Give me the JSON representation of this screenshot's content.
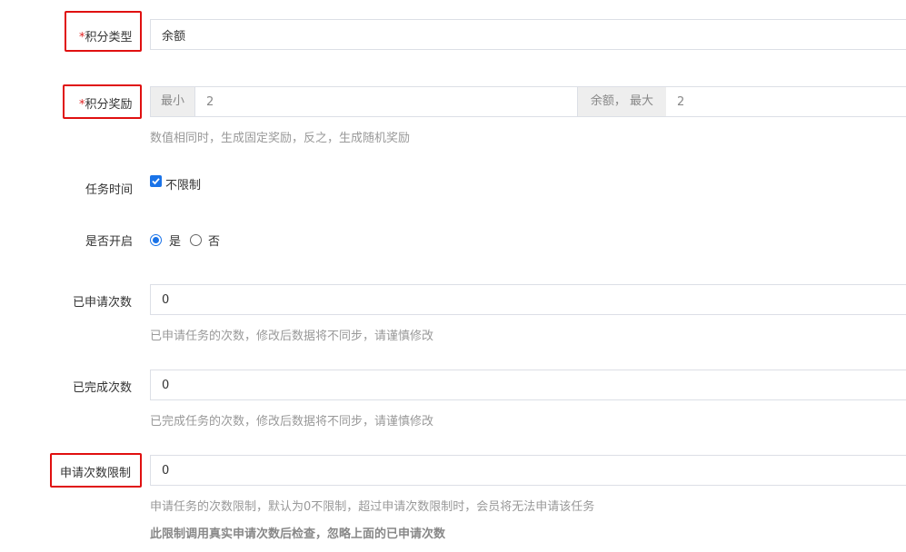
{
  "fields": {
    "points_type": {
      "label": "积分类型",
      "required_mark": "*",
      "value": "余额"
    },
    "points_reward": {
      "label": "积分奖励",
      "required_mark": "*",
      "min_addon": "最小",
      "min_value": "2",
      "max_addon": "余额， 最大",
      "max_value": "2",
      "help": "数值相同时，生成固定奖励，反之，生成随机奖励"
    },
    "task_time": {
      "label": "任务时间",
      "checkbox_label": "不限制",
      "checked": true
    },
    "enabled": {
      "label": "是否开启",
      "yes_label": "是",
      "no_label": "否",
      "selected": "是"
    },
    "applied_count": {
      "label": "已申请次数",
      "value": "0",
      "help": "已申请任务的次数，修改后数据将不同步，请谨慎修改"
    },
    "completed_count": {
      "label": "已完成次数",
      "value": "0",
      "help": "已完成任务的次数，修改后数据将不同步，请谨慎修改"
    },
    "apply_limit": {
      "label": "申请次数限制",
      "value": "0",
      "help": "申请任务的次数限制，默认为0不限制，超过申请次数限制时，会员将无法申请该任务",
      "note": "此限制调用真实申请次数后检查，忽略上面的已申请次数"
    }
  },
  "colors": {
    "accent": "#1a73e8",
    "highlight_box": "#e01010",
    "required": "#e02020",
    "help_text": "#999999"
  }
}
